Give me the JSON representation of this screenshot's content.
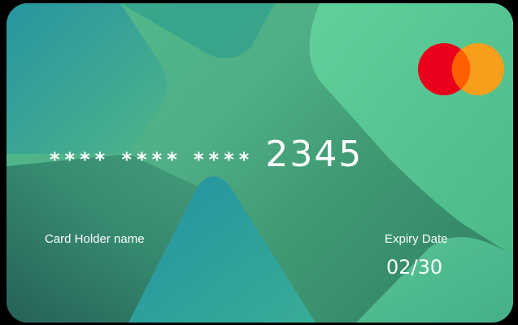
{
  "card": {
    "number_mask": "**** **** ****",
    "number_last4": "2345",
    "holder_label": "Card Holder name",
    "expiry_label": "Expiry Date",
    "expiry_value": "02/30",
    "brand_icon": "mastercard-logo-icon"
  },
  "colors": {
    "card_green": "#52bd8c",
    "card_dark": "#2e7f63",
    "card_teal": "#1d8fa5",
    "mastercard_red": "#eb001b",
    "mastercard_orange": "#f79e1b",
    "mastercard_overlap": "#ff5f00",
    "text": "#ffffff"
  }
}
